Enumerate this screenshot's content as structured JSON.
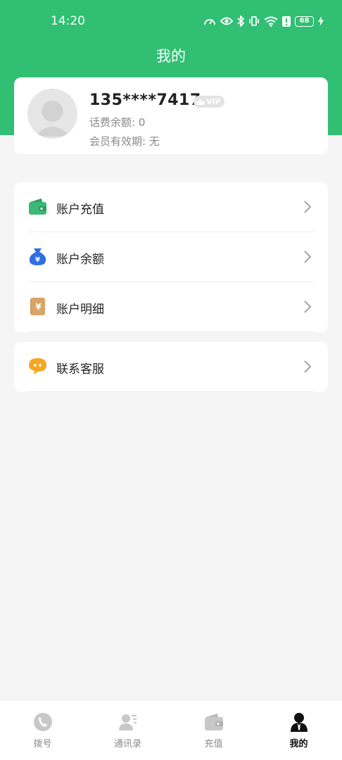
{
  "status_bar": {
    "time": "14:20",
    "battery": "68"
  },
  "page": {
    "title": "我的"
  },
  "profile": {
    "phone": "135****7417",
    "vip_badge": "VIP",
    "balance": "话费余额: 0",
    "expiry": "会员有效期: 无"
  },
  "menu_group_1": [
    {
      "label": "账户充值",
      "icon": "wallet-icon"
    },
    {
      "label": "账户余额",
      "icon": "money-bag-icon"
    },
    {
      "label": "账户明细",
      "icon": "receipt-icon"
    }
  ],
  "menu_group_2": [
    {
      "label": "联系客服",
      "icon": "chat-bubble-icon"
    }
  ],
  "tabbar": {
    "tabs": [
      {
        "label": "拨号",
        "icon": "phone-icon"
      },
      {
        "label": "通讯录",
        "icon": "contacts-icon"
      },
      {
        "label": "充值",
        "icon": "wallet-icon"
      },
      {
        "label": "我的",
        "icon": "user-icon",
        "active": true
      }
    ]
  },
  "colors": {
    "brand": "#30bf73",
    "wallet_green": "#3cb878",
    "bag_blue": "#2f6fe0",
    "receipt_tan": "#d9a36a",
    "chat_orange": "#f5a623"
  }
}
